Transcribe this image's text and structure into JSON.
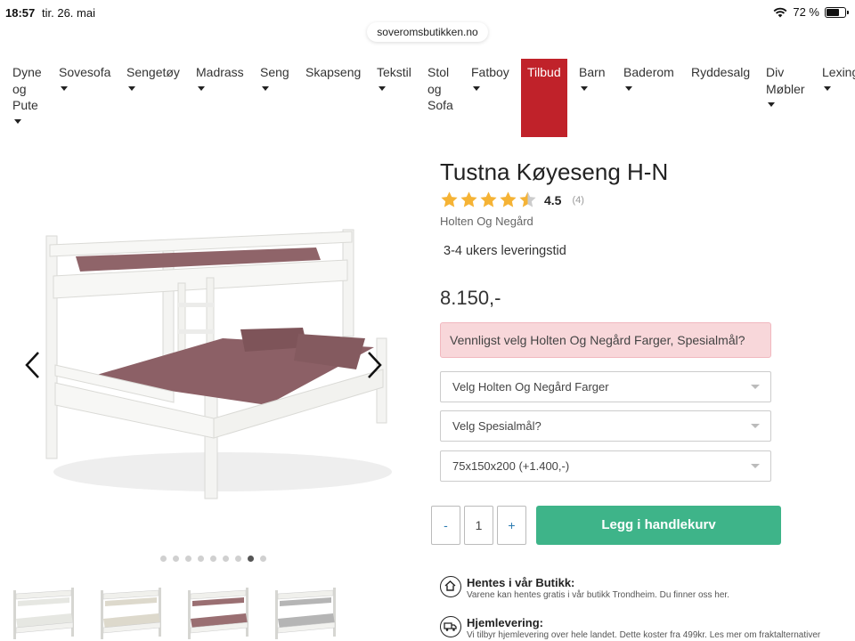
{
  "status_bar": {
    "time": "18:57",
    "date": "tir. 26. mai",
    "battery": "72 %",
    "battery_level": 0.72
  },
  "browser": {
    "url": "soveromsbutikken.no"
  },
  "nav": {
    "items": [
      {
        "label": "Dyne og Pute",
        "lines": [
          "Dyne",
          "og",
          "Pute"
        ],
        "has_dropdown": true
      },
      {
        "label": "Sovesofa",
        "lines": [
          "Sovesofa"
        ],
        "has_dropdown": true
      },
      {
        "label": "Sengetøy",
        "lines": [
          "Sengetøy"
        ],
        "has_dropdown": true
      },
      {
        "label": "Madrass",
        "lines": [
          "Madrass"
        ],
        "has_dropdown": true
      },
      {
        "label": "Seng",
        "lines": [
          "Seng"
        ],
        "has_dropdown": true
      },
      {
        "label": "Skapseng",
        "lines": [
          "Skapseng"
        ],
        "has_dropdown": false
      },
      {
        "label": "Tekstil",
        "lines": [
          "Tekstil"
        ],
        "has_dropdown": true
      },
      {
        "label": "Stol og Sofa",
        "lines": [
          "Stol",
          "og",
          "Sofa"
        ],
        "has_dropdown": false
      },
      {
        "label": "Fatboy",
        "lines": [
          "Fatboy"
        ],
        "has_dropdown": true
      },
      {
        "label": "Tilbud",
        "lines": [
          "Tilbud"
        ],
        "has_dropdown": false,
        "highlight": true
      },
      {
        "label": "Barn",
        "lines": [
          "Barn"
        ],
        "has_dropdown": true
      },
      {
        "label": "Baderom",
        "lines": [
          "Baderom"
        ],
        "has_dropdown": true
      },
      {
        "label": "Ryddesalg",
        "lines": [
          "Ryddesalg"
        ],
        "has_dropdown": false
      },
      {
        "label": "Div Møbler",
        "lines": [
          "Div",
          "Møbler"
        ],
        "has_dropdown": true
      },
      {
        "label": "Lexington",
        "lines": [
          "Lexing"
        ],
        "has_dropdown": true
      }
    ],
    "highlight_color": "#c0222a"
  },
  "product": {
    "title": "Tustna Køyeseng H-N",
    "rating_value": "4.5",
    "rating_stars": 4.5,
    "rating_count": "(4)",
    "brand": "Holten Og Negård",
    "delivery_time": "3-4 ukers leveringstid",
    "price": "8.150,-",
    "alert": "Vennligst velg Holten Og Negård Farger, Spesialmål?",
    "selects": [
      {
        "value": "Velg Holten Og Negård Farger"
      },
      {
        "value": "Velg Spesialmål?"
      },
      {
        "value": "75x150x200 (+1.400,-)"
      }
    ],
    "quantity": "1",
    "qty_minus": "-",
    "qty_plus": "+",
    "add_to_cart": "Legg i handlekurv"
  },
  "gallery": {
    "dot_count": 9,
    "active_dot": 7,
    "thumb_count": 4
  },
  "info": {
    "pickup_title": "Hentes i vår Butikk:",
    "pickup_text": "Varene kan hentes gratis i vår butikk Trondheim. Du finner oss her.",
    "delivery_title": "Hjemlevering:",
    "delivery_text": "Vi tilbyr hjemlevering over hele landet. Dette koster fra 499kr. Les mer om fraktalternativer"
  },
  "colors": {
    "accent_green": "#3eb489",
    "star_gold": "#f5b335",
    "alert_bg": "#f8d7da"
  }
}
